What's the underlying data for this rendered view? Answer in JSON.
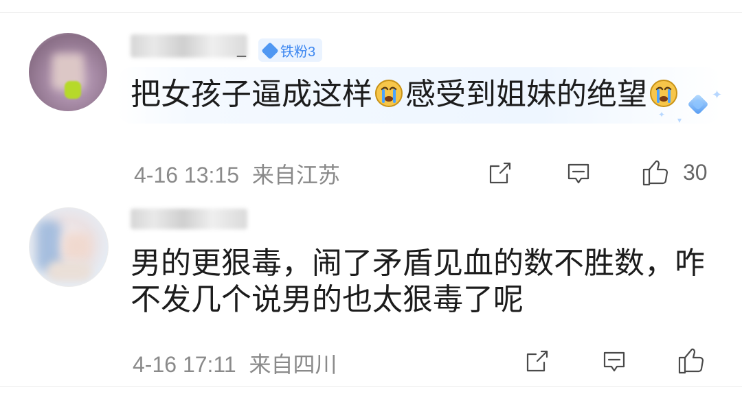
{
  "comments": [
    {
      "username_visible_suffix": "_",
      "fan_badge": "铁粉3",
      "text_part1": "把女孩子逼成这样",
      "text_part2": "感受到姐妹的绝望",
      "emoji_1": "crying-face-emoji",
      "emoji_2": "crying-face-emoji",
      "time": "4-16 13:15",
      "location": "来自江苏",
      "share_icon": "share-icon",
      "comment_icon": "comment-icon",
      "like_icon": "thumbs-up-icon",
      "likes": "30"
    },
    {
      "text": "男的更狠毒，闹了矛盾见血的数不胜数，咋不发几个说男的也太狠毒了呢",
      "time": "4-16 17:11",
      "location": "来自四川",
      "share_icon": "share-icon",
      "comment_icon": "comment-icon",
      "like_icon": "thumbs-up-icon",
      "likes": ""
    }
  ],
  "colors": {
    "text": "#1c1c1c",
    "meta": "#8a8a8a",
    "badge_bg": "#eaf3ff",
    "badge_text": "#3b86f0",
    "divider": "#ebebeb"
  }
}
